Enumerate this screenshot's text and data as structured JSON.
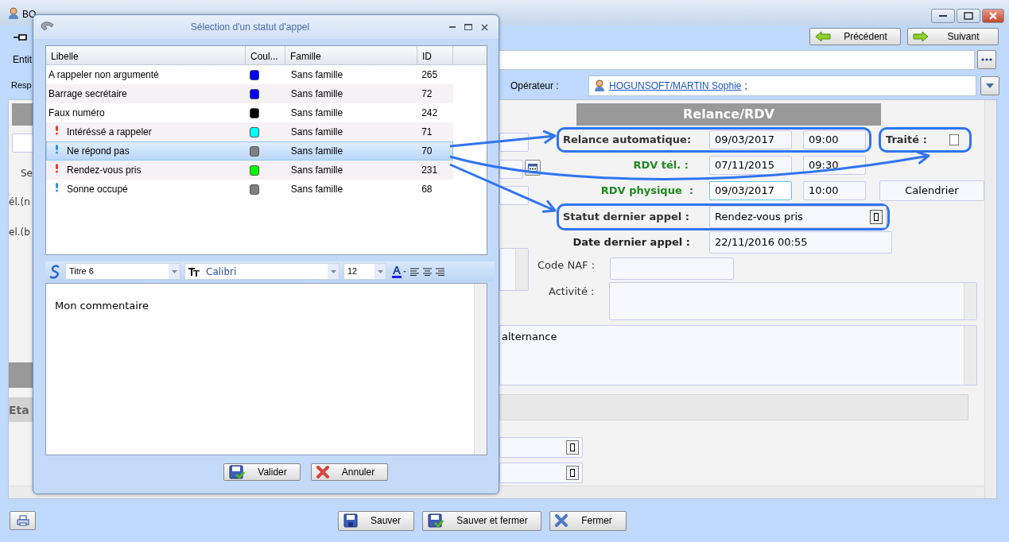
{
  "window": {
    "title": "BO"
  },
  "nav_buttons": [
    {
      "kind": "previous",
      "label": "Précédent"
    },
    {
      "kind": "next",
      "label": "Suivant"
    }
  ],
  "entity": {
    "label": "Entit"
  },
  "responsible": {
    "label": "Resp"
  },
  "operator": {
    "label": "Opérateur :",
    "user": "HOGUNSOFT/MARTIN Sophie",
    "separator": ";"
  },
  "left_panel": {
    "labels": [
      "Se",
      "él.(n",
      "el.(b"
    ],
    "section": "Eta"
  },
  "relance": {
    "title": "Relance/RDV",
    "auto": {
      "label": "Relance automatique:",
      "date": "09/03/2017",
      "time": "09:00",
      "highlighted": true
    },
    "treated": {
      "label": "Traité :",
      "checked": false,
      "highlighted": true
    },
    "phone_meeting": {
      "label": "RDV tél. :",
      "date": "07/11/2015",
      "time": "09:30"
    },
    "visit": {
      "label": "RDV physique  :",
      "date": "09/03/2017",
      "time": "10:00",
      "focused": true,
      "button": "Calendrier"
    },
    "last_status": {
      "label": "Statut dernier appel :",
      "value": "Rendez-vous pris",
      "highlighted": true
    },
    "last_call": {
      "label": "Date dernier appel :",
      "value": "22/11/2016 00:55"
    }
  },
  "naf": {
    "label": "Code NAF :"
  },
  "activity": {
    "label": "Activité :"
  },
  "notes": {
    "value": "alternance"
  },
  "footer_buttons": [
    {
      "kind": "save",
      "label": "Sauver"
    },
    {
      "kind": "save_close",
      "label": "Sauver et fermer"
    },
    {
      "kind": "close",
      "label": "Fermer"
    }
  ],
  "dialog": {
    "title": "Sélection d'un statut d'appel",
    "columns": [
      "Libelle",
      "Coul...",
      "Famille",
      "ID"
    ],
    "rows": [
      {
        "kind": "plain",
        "label": "A rappeler non argumenté",
        "color": "#0000ff",
        "family": "Sans famille",
        "id": "265",
        "selected": false
      },
      {
        "kind": "plain",
        "label": "Barrage secrétaire",
        "color": "#0000ff",
        "family": "Sans famille",
        "id": "72",
        "selected": false
      },
      {
        "kind": "plain",
        "label": "Faux numéro",
        "color": "#000000",
        "family": "Sans famille",
        "id": "242",
        "selected": false
      },
      {
        "kind": "alert",
        "label": "Intéréssé a rappeler",
        "color": "#00ffff",
        "family": "Sans famille",
        "id": "71",
        "selected": false
      },
      {
        "kind": "notice",
        "label": "Ne répond pas",
        "color": "#808080",
        "family": "Sans famille",
        "id": "70",
        "selected": true
      },
      {
        "kind": "alert",
        "label": "Rendez-vous pris",
        "color": "#00ff00",
        "family": "Sans famille",
        "id": "231",
        "selected": false
      },
      {
        "kind": "notice",
        "label": "Sonne occupé",
        "color": "#808080",
        "family": "Sans famille",
        "id": "68",
        "selected": false
      }
    ],
    "editor": {
      "style": "Titre 6",
      "font": "Calibri",
      "size": "12",
      "text": "Mon commentaire"
    },
    "buttons": [
      {
        "kind": "validate",
        "label": "Valider"
      },
      {
        "kind": "cancel",
        "label": "Annuler"
      }
    ]
  }
}
